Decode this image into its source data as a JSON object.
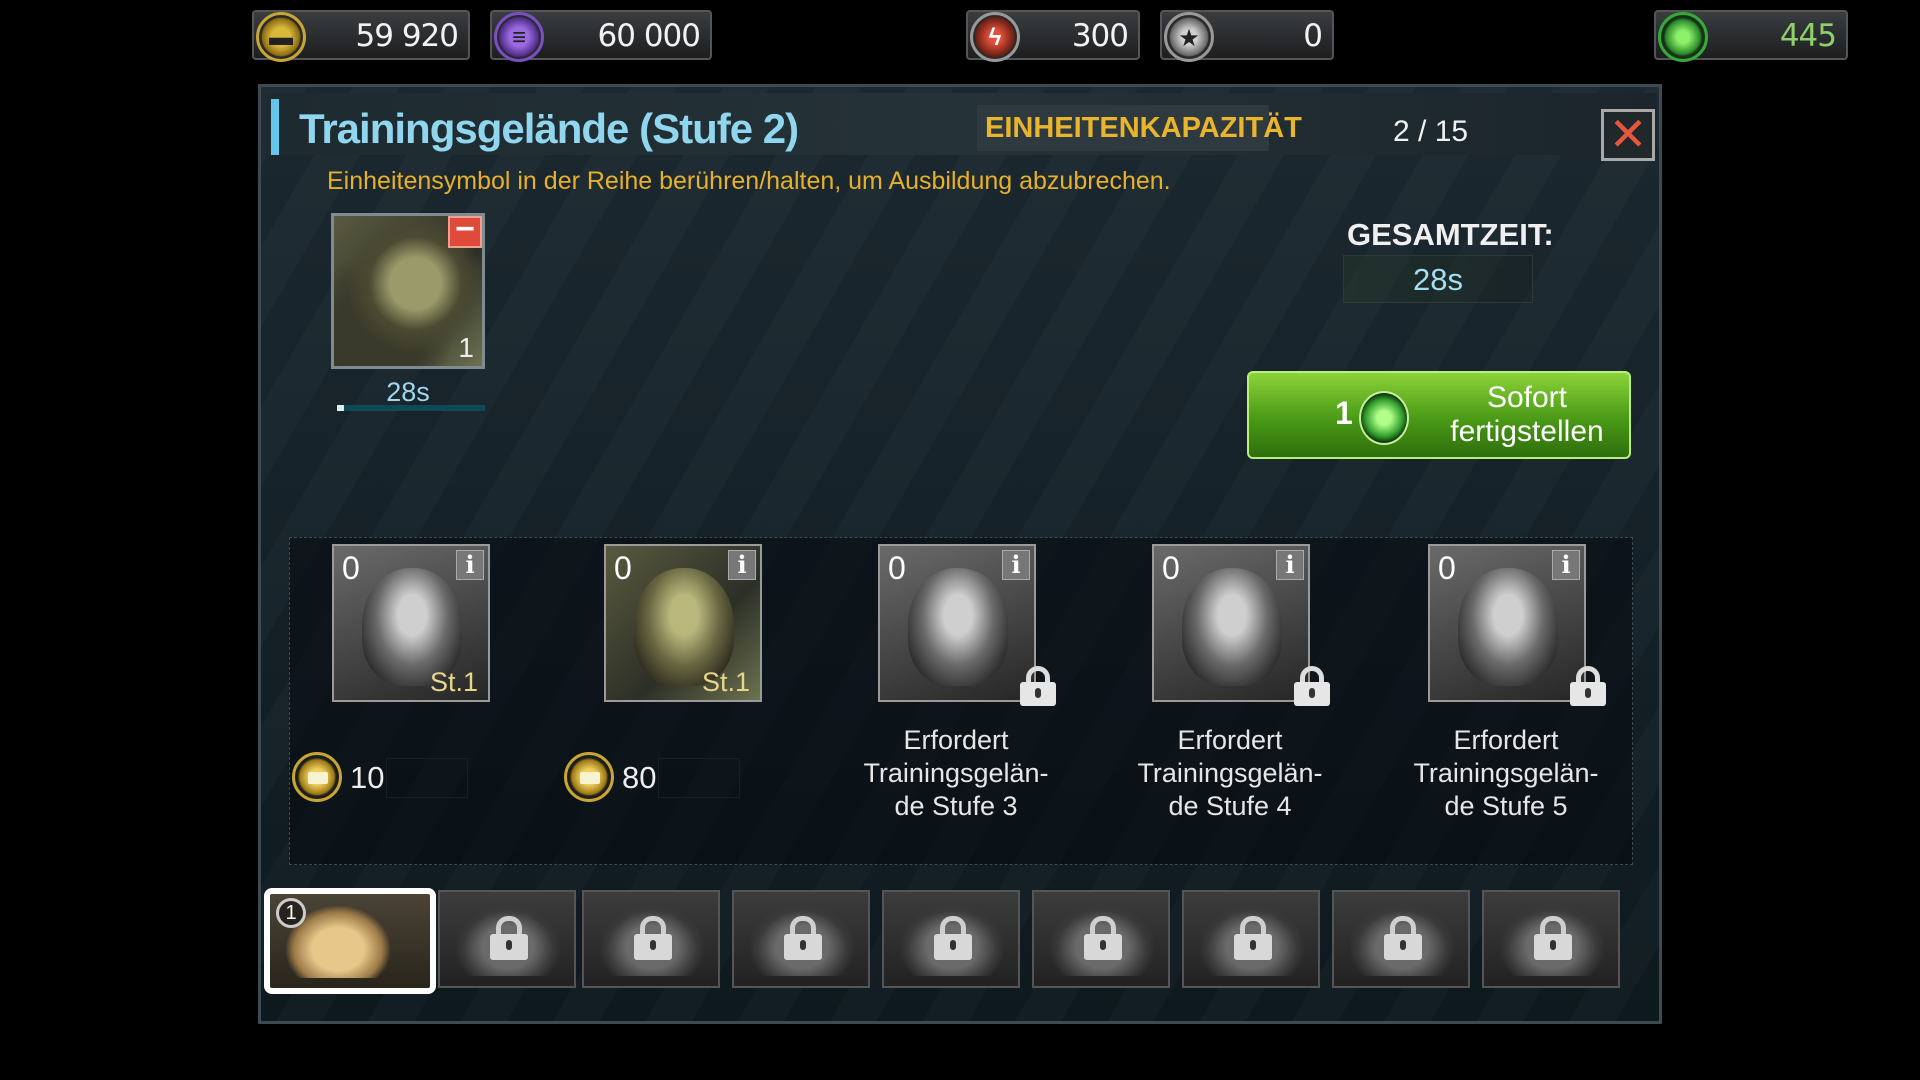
{
  "resources": {
    "gold": "59 920",
    "oil": "60 000",
    "energy": "300",
    "medals": "0",
    "gems": "445"
  },
  "dialog": {
    "title": "Trainingsgelände (Stufe 2)",
    "capacity_label": "EINHEITENKAPAZITÄT",
    "capacity_value": "2 / 15",
    "close_label": "✕",
    "hint": "Einheitensymbol in der Reihe berühren/halten, um Ausbildung abzubrechen."
  },
  "queue": {
    "count": "1",
    "time": "28s",
    "progress": 0.05
  },
  "total": {
    "label": "GESAMTZEIT:",
    "value": "28s"
  },
  "finish": {
    "cost": "1",
    "label_line1": "Sofort",
    "label_line2": "fertigstellen"
  },
  "units": [
    {
      "count": "0",
      "level": "St.1",
      "cost": "10",
      "locked": false
    },
    {
      "count": "0",
      "level": "St.1",
      "cost": "80",
      "locked": false
    },
    {
      "count": "0",
      "locked": true,
      "req1": "Erfordert",
      "req2": "Trainingsgelän-",
      "req3": "de Stufe 3"
    },
    {
      "count": "0",
      "locked": true,
      "req1": "Erfordert",
      "req2": "Trainingsgelän-",
      "req3": "de Stufe 4"
    },
    {
      "count": "0",
      "locked": true,
      "req1": "Erfordert",
      "req2": "Trainingsgelän-",
      "req3": "de Stufe 5"
    }
  ],
  "buildings": {
    "active_badge": "1"
  },
  "colors": {
    "title": "#8fd6ee",
    "accent": "#e9b52c",
    "button_green": "#4a9a16"
  }
}
